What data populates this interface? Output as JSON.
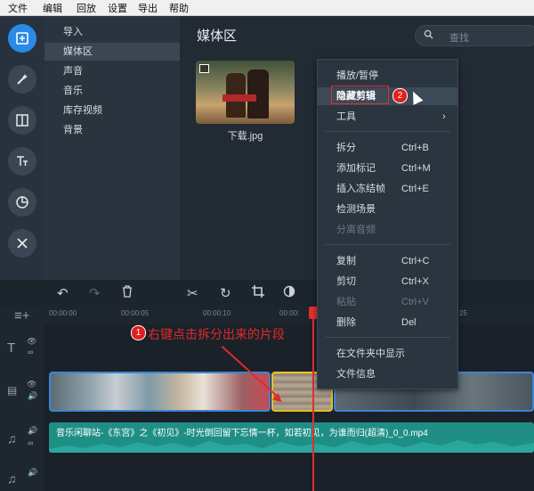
{
  "menubar": [
    "文件",
    "编辑",
    "回放",
    "设置",
    "导出",
    "帮助"
  ],
  "sidebar": {
    "items": [
      {
        "label": "导入",
        "selected": false
      },
      {
        "label": "媒体区",
        "selected": true
      },
      {
        "label": "声音",
        "selected": false
      },
      {
        "label": "音乐",
        "selected": false
      },
      {
        "label": "库存视频",
        "selected": false
      },
      {
        "label": "背景",
        "selected": false
      }
    ],
    "tools": [
      "import-icon",
      "magic-wand-icon",
      "transition-icon",
      "text-icon",
      "clock-icon",
      "tools-icon"
    ]
  },
  "media": {
    "title": "媒体区",
    "search_placeholder": "查找",
    "file_name": "下载.jpg"
  },
  "context_menu": {
    "items": [
      {
        "label": "播放/暂停",
        "shortcut": "",
        "disabled": false,
        "highlighted": false
      },
      {
        "label": "隐藏剪辑",
        "shortcut": "",
        "disabled": false,
        "highlighted": true
      },
      {
        "label": "工具",
        "shortcut": "",
        "disabled": false,
        "highlighted": false,
        "submenu": true
      },
      {
        "label": "拆分",
        "shortcut": "Ctrl+B",
        "disabled": false
      },
      {
        "label": "添加标记",
        "shortcut": "Ctrl+M",
        "disabled": false
      },
      {
        "label": "插入冻结帧",
        "shortcut": "Ctrl+E",
        "disabled": false
      },
      {
        "label": "检测场景",
        "shortcut": "",
        "disabled": false
      },
      {
        "label": "分离音频",
        "shortcut": "",
        "disabled": true
      },
      {
        "label": "复制",
        "shortcut": "Ctrl+C",
        "disabled": false
      },
      {
        "label": "剪切",
        "shortcut": "Ctrl+X",
        "disabled": false
      },
      {
        "label": "粘贴",
        "shortcut": "Ctrl+V",
        "disabled": true
      },
      {
        "label": "删除",
        "shortcut": "Del",
        "disabled": false
      },
      {
        "label": "在文件夹中显示",
        "shortcut": "",
        "disabled": false
      },
      {
        "label": "文件信息",
        "shortcut": "",
        "disabled": false
      }
    ]
  },
  "annotations": {
    "step1_number": "1",
    "step1_text": "右键点击拆分出来的片段",
    "step2_number": "2"
  },
  "timeline": {
    "ticks": [
      "00:00:00",
      "00:00:05",
      "00:00:10",
      "00:00:",
      "25"
    ],
    "audio_clip_label": "音乐闲聊站-《东宫》之《初见》-时光倒回留下忘情一杯，如若初见，为谁而归(超清)_0_0.mp4"
  },
  "colors": {
    "accent": "#2b8ae8",
    "annotation_red": "#e02b2b",
    "audio_track": "#1f8f86",
    "selected_clip": "#e8c31a"
  }
}
